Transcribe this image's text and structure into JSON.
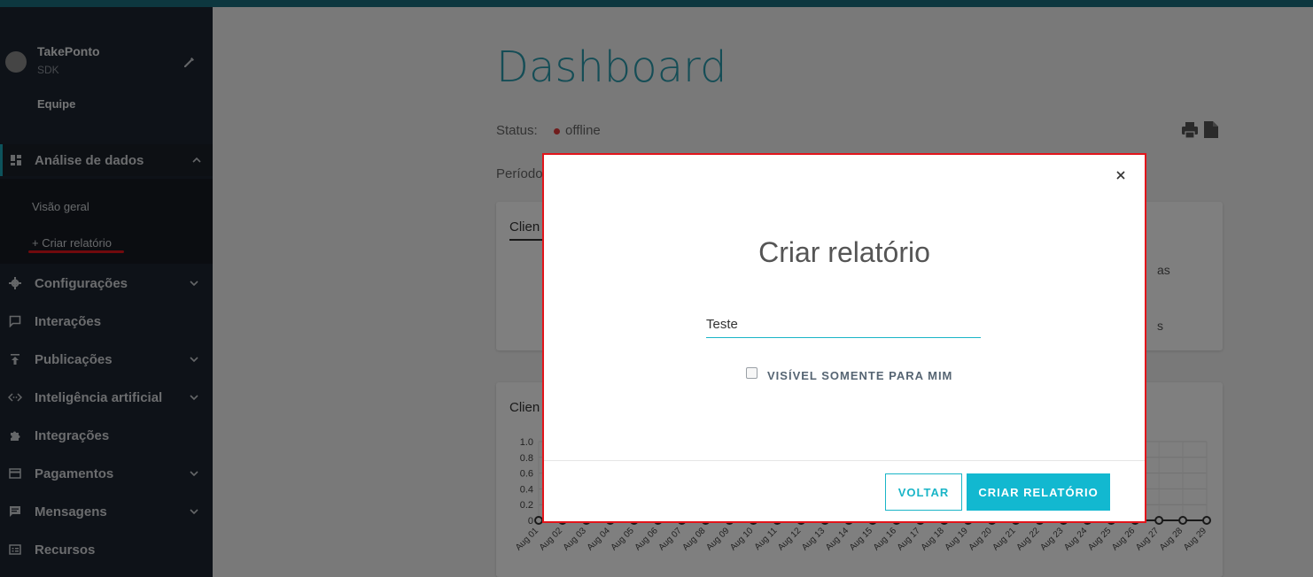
{
  "sidebar": {
    "bot_name": "TakePonto",
    "bot_sub": "SDK",
    "team": "Equipe",
    "active_item": "Análise de dados",
    "sub_items": [
      "Visão geral",
      "+ Criar relatório"
    ],
    "items": [
      {
        "label": "Configurações",
        "icon": "gear-icon"
      },
      {
        "label": "Interações",
        "icon": "chat-icon"
      },
      {
        "label": "Publicações",
        "icon": "upload-icon"
      },
      {
        "label": "Inteligência artificial",
        "icon": "code-arrows-icon"
      },
      {
        "label": "Integrações",
        "icon": "puzzle-icon"
      },
      {
        "label": "Pagamentos",
        "icon": "credit-card-icon"
      },
      {
        "label": "Mensagens",
        "icon": "message-icon"
      },
      {
        "label": "Recursos",
        "icon": "resources-icon"
      }
    ]
  },
  "main": {
    "title": "Dashboard",
    "status_label": "Status:",
    "status_value": "offline",
    "periodo_label": "Período",
    "card1_title": "Clien",
    "card1_side_1": "as",
    "card1_side_2": "s",
    "card2_title": "Clien"
  },
  "chart_data": {
    "type": "line",
    "y_ticks": [
      "1.0",
      "0.8",
      "0.6",
      "0.4",
      "0.2",
      "0"
    ],
    "ylim": [
      0,
      1.0
    ],
    "x_labels": [
      "Aug 01",
      "Aug 02",
      "Aug 03",
      "Aug 04",
      "Aug 05",
      "Aug 06",
      "Aug 07",
      "Aug 08",
      "Aug 09",
      "Aug 10",
      "Aug 11",
      "Aug 12",
      "Aug 13",
      "Aug 14",
      "Aug 15",
      "Aug 16",
      "Aug 17",
      "Aug 18",
      "Aug 19",
      "Aug 20",
      "Aug 21",
      "Aug 22",
      "Aug 23",
      "Aug 24",
      "Aug 25",
      "Aug 26",
      "Aug 27",
      "Aug 28",
      "Aug 29"
    ],
    "values": [
      0,
      0,
      0,
      0,
      0,
      0,
      0,
      0,
      0,
      0,
      0,
      0,
      0,
      0,
      0,
      0,
      0,
      0,
      0,
      0,
      0,
      0,
      0,
      0,
      0,
      0,
      0,
      0,
      0
    ]
  },
  "modal": {
    "title": "Criar relatório",
    "input_value": "Teste",
    "checkbox_label": "VISÍVEL SOMENTE PARA MIM",
    "back_label": "VOLTAR",
    "create_label": "CRIAR RELATÓRIO"
  },
  "colors": {
    "accent": "#12b8d0",
    "sidebar_bg": "#1d2430",
    "highlight": "#e2151b"
  }
}
